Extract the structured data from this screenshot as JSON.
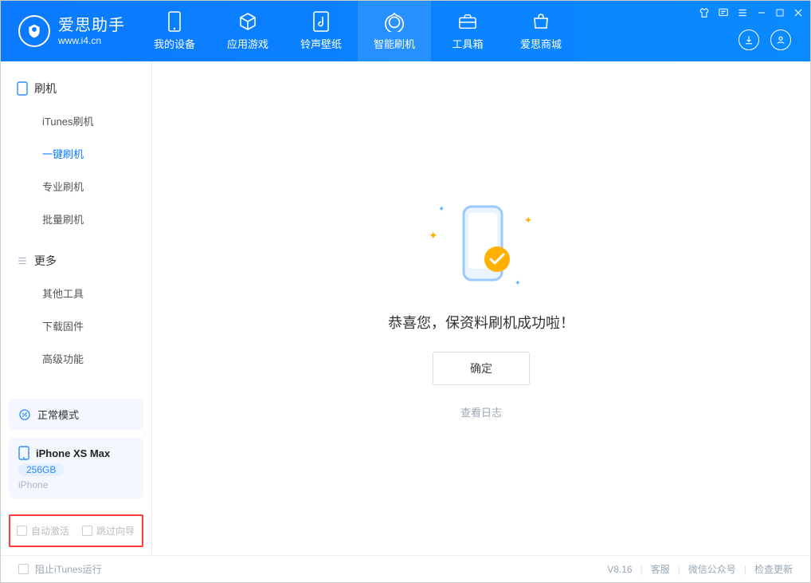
{
  "app": {
    "title": "爱思助手",
    "site": "www.i4.cn"
  },
  "header_tabs": [
    {
      "label": "我的设备",
      "icon": "device"
    },
    {
      "label": "应用游戏",
      "icon": "apps"
    },
    {
      "label": "铃声壁纸",
      "icon": "music"
    },
    {
      "label": "智能刷机",
      "icon": "flash",
      "active": true
    },
    {
      "label": "工具箱",
      "icon": "toolbox"
    },
    {
      "label": "爱思商城",
      "icon": "store"
    }
  ],
  "sidebar": {
    "group1": {
      "title": "刷机",
      "items": [
        "iTunes刷机",
        "一键刷机",
        "专业刷机",
        "批量刷机"
      ],
      "active_index": 1
    },
    "group2": {
      "title": "更多",
      "items": [
        "其他工具",
        "下载固件",
        "高级功能"
      ]
    }
  },
  "mode_card": {
    "label": "正常模式"
  },
  "device_card": {
    "name": "iPhone XS Max",
    "capacity": "256GB",
    "subtitle": "iPhone"
  },
  "options": {
    "auto_activate": "自动激活",
    "skip_guide": "跳过向导"
  },
  "main": {
    "success_msg": "恭喜您，保资料刷机成功啦！",
    "confirm_btn": "确定",
    "view_log": "查看日志"
  },
  "footer": {
    "block_itunes": "阻止iTunes运行",
    "version": "V8.16",
    "links": [
      "客服",
      "微信公众号",
      "检查更新"
    ]
  }
}
